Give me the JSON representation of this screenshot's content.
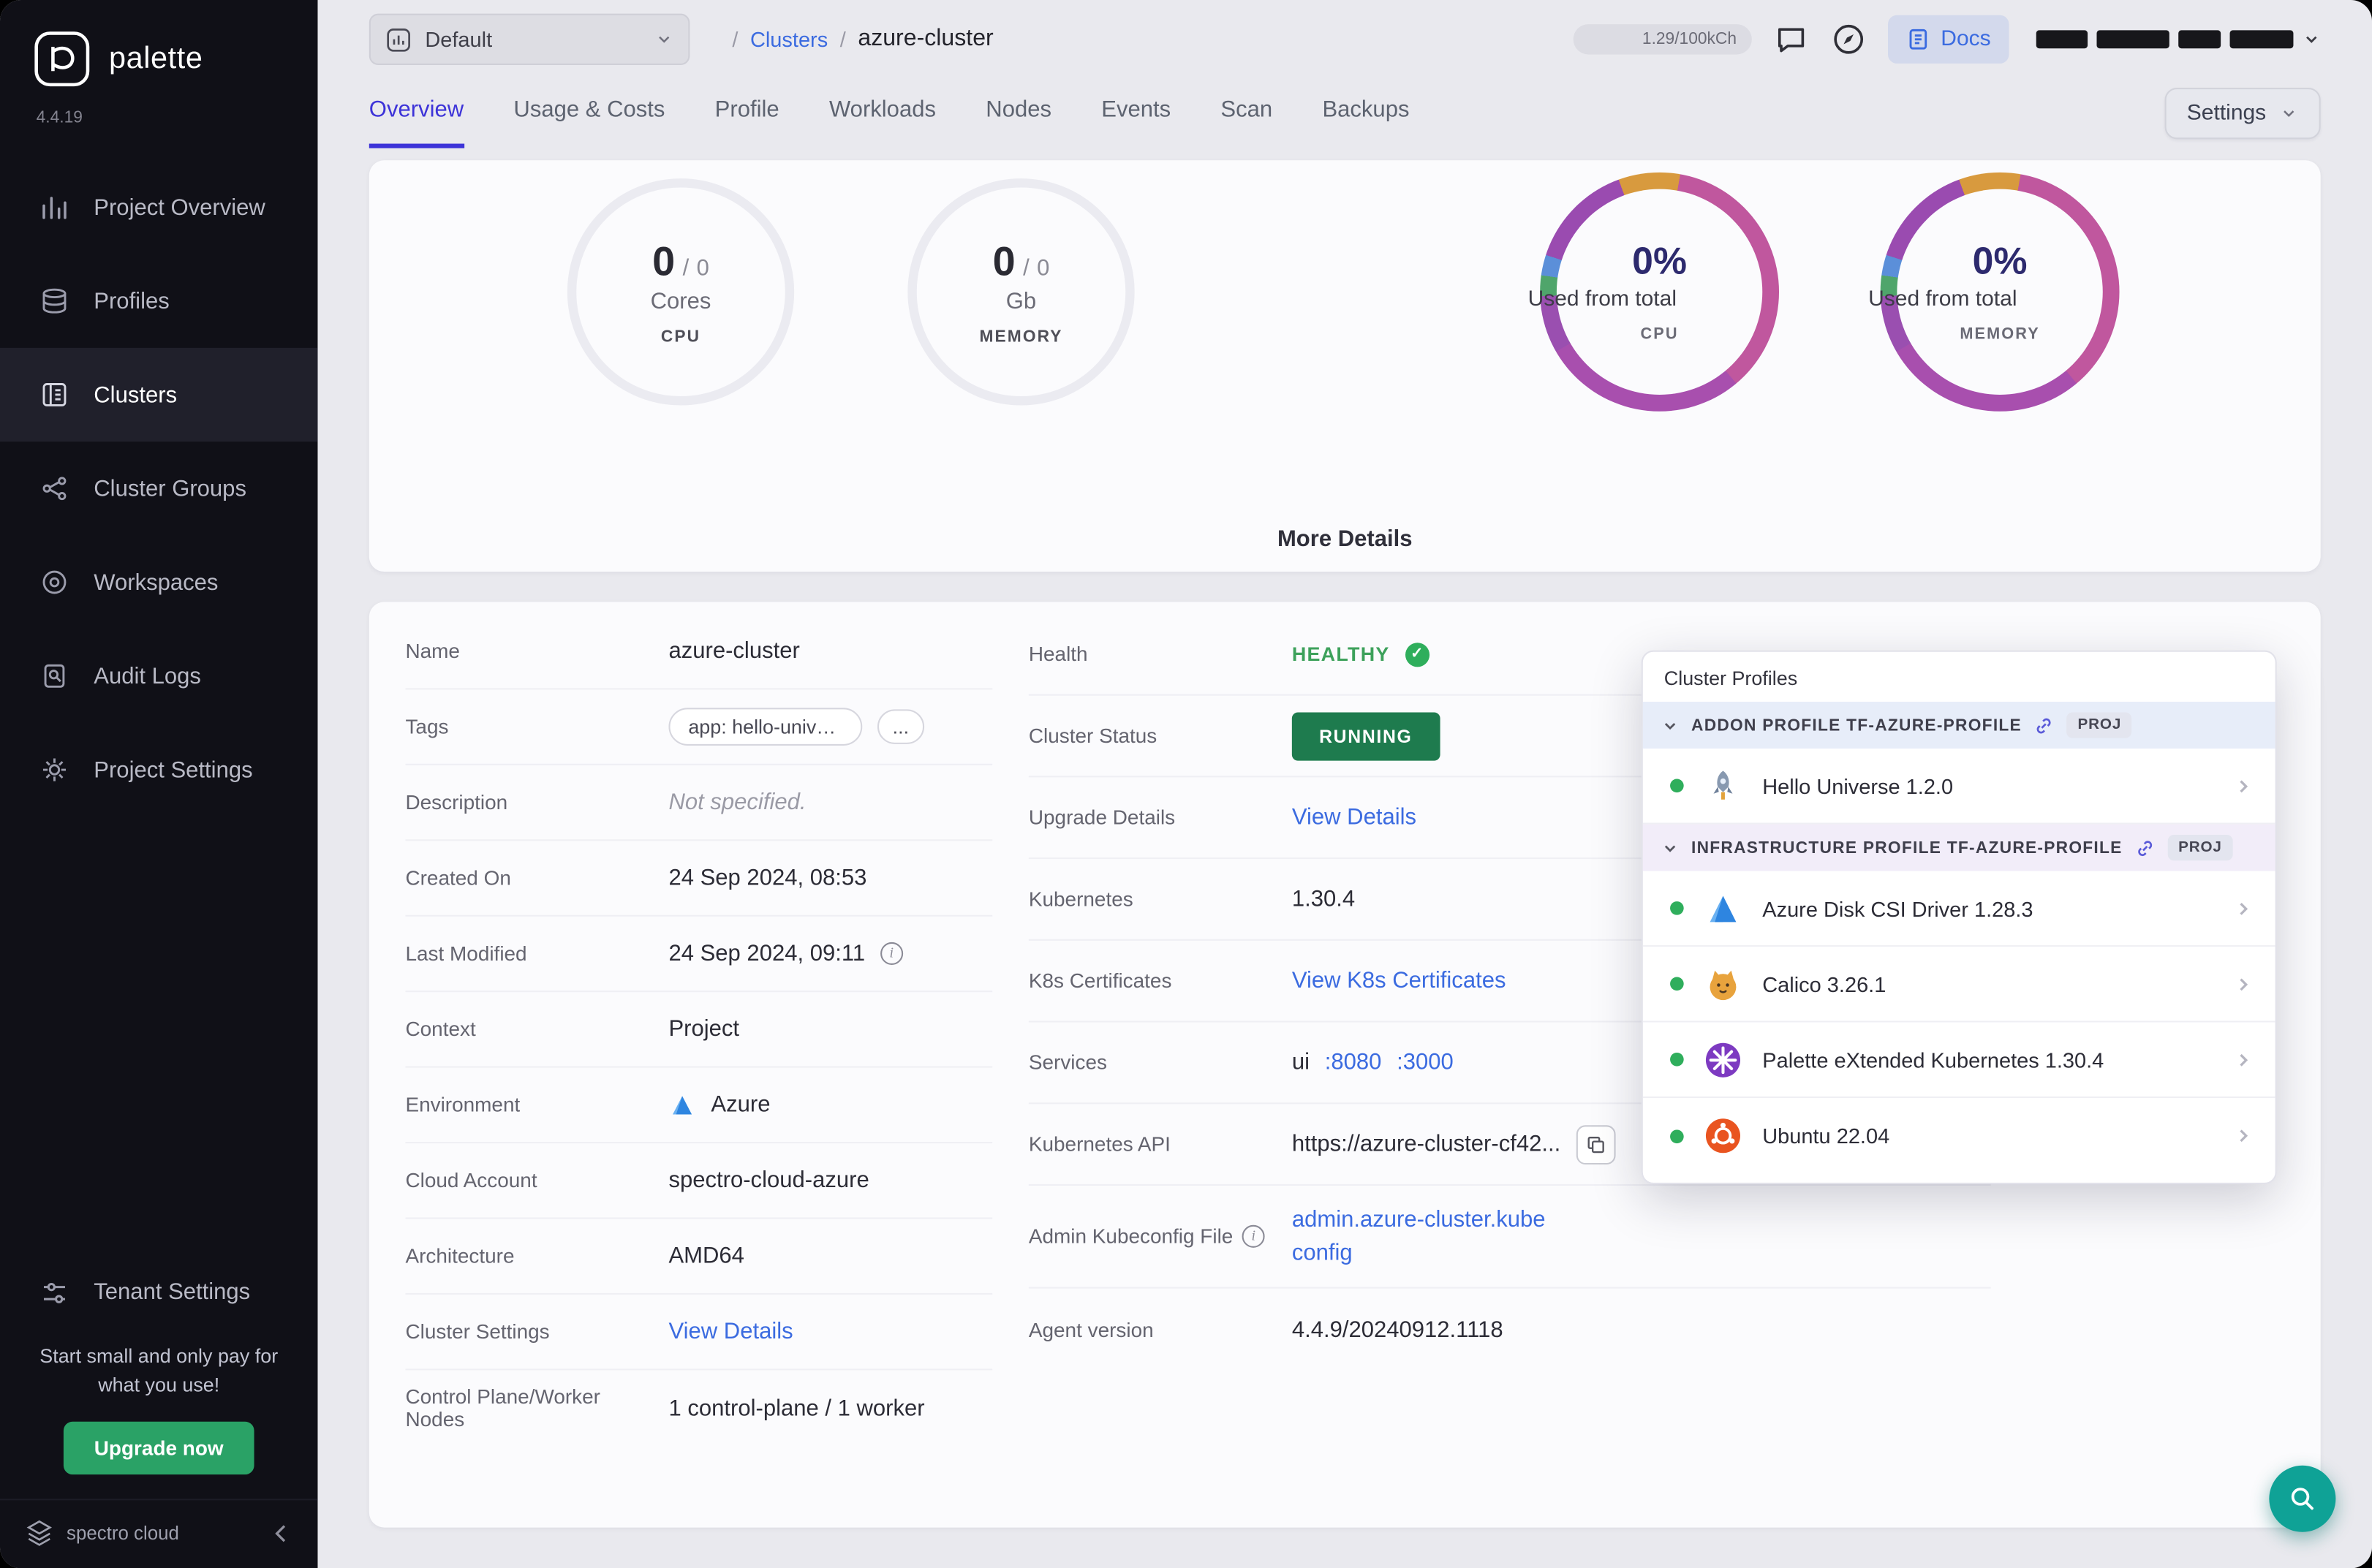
{
  "app": {
    "name": "palette",
    "version": "4.4.19"
  },
  "sidebar": {
    "logo_text": "palette",
    "version": "4.4.19",
    "items": [
      {
        "label": "Project Overview"
      },
      {
        "label": "Profiles"
      },
      {
        "label": "Clusters",
        "active": true
      },
      {
        "label": "Cluster Groups"
      },
      {
        "label": "Workspaces"
      },
      {
        "label": "Audit Logs"
      },
      {
        "label": "Project Settings"
      }
    ],
    "tenant_settings_label": "Tenant Settings",
    "promo_text": "Start small and only pay for what you use!",
    "upgrade_button_label": "Upgrade now",
    "brand_footer": "spectro cloud"
  },
  "header": {
    "project_selector_value": "Default",
    "breadcrumb": {
      "separator": "/",
      "section": "Clusters",
      "current": "azure-cluster"
    },
    "usage_meter": "1.29/100kCh",
    "docs_button_label": "Docs"
  },
  "tabs": {
    "items": [
      "Overview",
      "Usage & Costs",
      "Profile",
      "Workloads",
      "Nodes",
      "Events",
      "Scan",
      "Backups"
    ],
    "active": "Overview",
    "settings_button_label": "Settings"
  },
  "metrics": {
    "gauges": [
      {
        "value": "0",
        "separator": "/",
        "total": "0",
        "unit": "Cores",
        "caption": "CPU"
      },
      {
        "value": "0",
        "separator": "/",
        "total": "0",
        "unit": "Gb",
        "caption": "MEMORY"
      }
    ],
    "donuts": [
      {
        "percent": "0%",
        "label": "Used from total",
        "caption": "CPU"
      },
      {
        "percent": "0%",
        "label": "Used from total",
        "caption": "MEMORY"
      }
    ],
    "more_details_label": "More Details"
  },
  "details": {
    "left": [
      {
        "label": "Name",
        "value": "azure-cluster"
      },
      {
        "label": "Tags",
        "value": "app: hello-univer...",
        "more": "..."
      },
      {
        "label": "Description",
        "value": "Not specified."
      },
      {
        "label": "Created On",
        "value": "24 Sep 2024, 08:53"
      },
      {
        "label": "Last Modified",
        "value": "24 Sep 2024, 09:11"
      },
      {
        "label": "Context",
        "value": "Project"
      },
      {
        "label": "Environment",
        "value": "Azure"
      },
      {
        "label": "Cloud Account",
        "value": "spectro-cloud-azure"
      },
      {
        "label": "Architecture",
        "value": "AMD64"
      },
      {
        "label": "Cluster Settings",
        "value": "View Details"
      },
      {
        "label": "Control Plane/Worker Nodes",
        "value": "1 control-plane / 1 worker"
      }
    ],
    "right": [
      {
        "label": "Health",
        "value": "HEALTHY"
      },
      {
        "label": "Cluster Status",
        "value": "RUNNING"
      },
      {
        "label": "Upgrade Details",
        "value": "View Details"
      },
      {
        "label": "Kubernetes",
        "value": "1.30.4"
      },
      {
        "label": "K8s Certificates",
        "value": "View K8s Certificates"
      },
      {
        "label": "Services",
        "value": "ui",
        "ports": [
          ":8080",
          ":3000"
        ]
      },
      {
        "label": "Kubernetes API",
        "value": "https://azure-cluster-cf42..."
      },
      {
        "label": "Admin Kubeconfig File",
        "value": "admin.azure-cluster.kubeconfig"
      },
      {
        "label": "Agent version",
        "value": "4.4.9/20240912.1118"
      }
    ]
  },
  "cluster_profiles": {
    "title": "Cluster Profiles",
    "sections": [
      {
        "header": "ADDON PROFILE TF-AZURE-PROFILE",
        "badge": "PROJ",
        "items": [
          {
            "name": "Hello Universe 1.2.0",
            "icon": "hello-universe-icon"
          }
        ]
      },
      {
        "header": "INFRASTRUCTURE PROFILE TF-AZURE-PROFILE",
        "badge": "PROJ",
        "items": [
          {
            "name": "Azure Disk CSI Driver 1.28.3",
            "icon": "azure-icon"
          },
          {
            "name": "Calico 3.26.1",
            "icon": "calico-icon"
          },
          {
            "name": "Palette eXtended Kubernetes 1.30.4",
            "icon": "palette-k8s-icon"
          },
          {
            "name": "Ubuntu 22.04",
            "icon": "ubuntu-icon"
          }
        ]
      }
    ]
  },
  "colors": {
    "accent_blue": "#3b6be0",
    "tab_active": "#3d33d8",
    "green": "#2fae5c",
    "running_bg": "#1e7b4e",
    "fab_teal": "#0fa296",
    "donut_pink": "#c0579e",
    "donut_purple": "#a84fae",
    "donut_orange": "#d89a3e"
  }
}
